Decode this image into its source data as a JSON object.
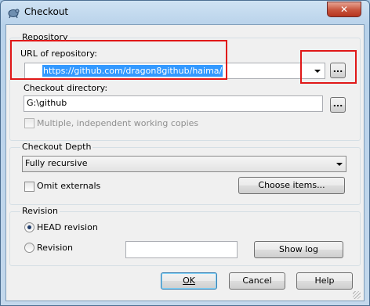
{
  "window": {
    "title": "Checkout",
    "close_label": "✕"
  },
  "repository": {
    "group_label": "Repository",
    "url_label": "URL of repository:",
    "url_value": "https://github.com/dragon8github/haima/",
    "browse_label": "...",
    "checkout_dir_label": "Checkout directory:",
    "checkout_dir_value": "G:\\github",
    "dir_browse_label": "...",
    "multiple_wc_label": "Multiple, independent working copies"
  },
  "depth": {
    "group_label": "Checkout Depth",
    "selected": "Fully recursive",
    "omit_externals_label": "Omit externals",
    "choose_items_label": "Choose items..."
  },
  "revision": {
    "group_label": "Revision",
    "head_label": "HEAD revision",
    "revision_label": "Revision",
    "revision_value": "",
    "show_log_label": "Show log"
  },
  "footer": {
    "ok_label": "OK",
    "cancel_label": "Cancel",
    "help_label": "Help"
  },
  "colors": {
    "highlight": "#e01818",
    "selection": "#3399ff"
  }
}
